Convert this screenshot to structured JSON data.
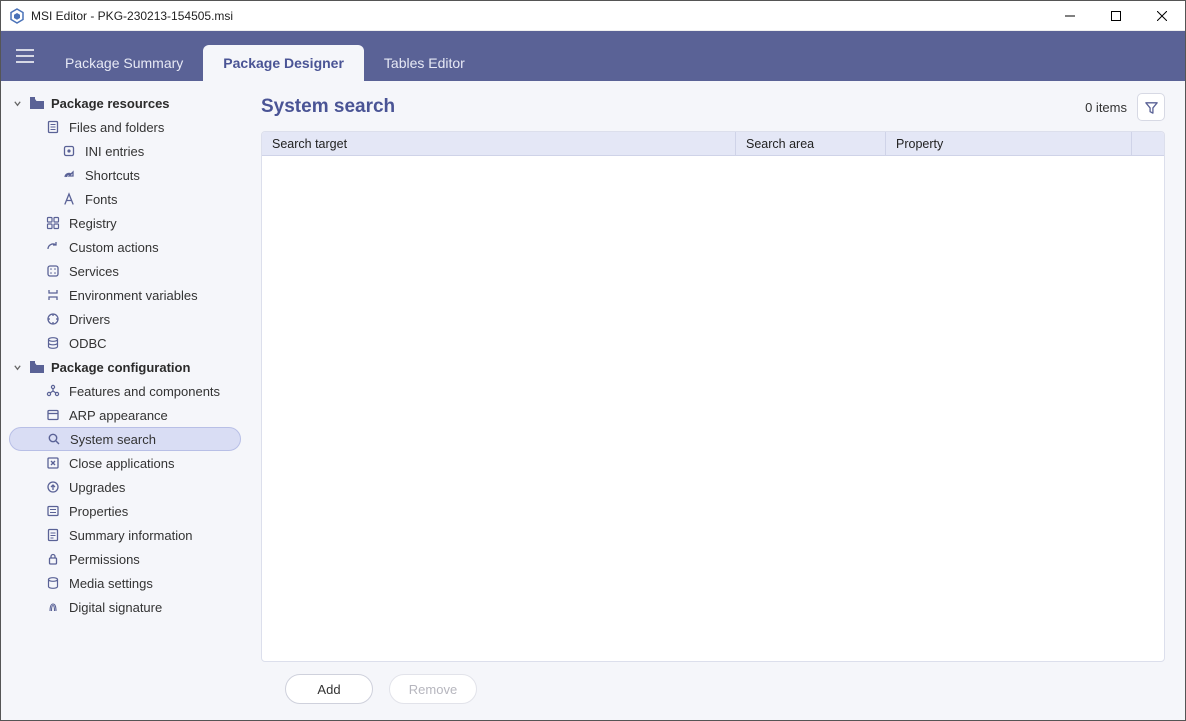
{
  "window": {
    "title": "MSI Editor - PKG-230213-154505.msi"
  },
  "nav": {
    "tabs": [
      {
        "label": "Package Summary",
        "active": false
      },
      {
        "label": "Package Designer",
        "active": true
      },
      {
        "label": "Tables Editor",
        "active": false
      }
    ]
  },
  "sidebar": {
    "resources": {
      "label": "Package resources",
      "items": {
        "files": {
          "label": "Files and folders"
        },
        "ini": {
          "label": "INI entries"
        },
        "shortcuts": {
          "label": "Shortcuts"
        },
        "fonts": {
          "label": "Fonts"
        },
        "registry": {
          "label": "Registry"
        },
        "custom": {
          "label": "Custom actions"
        },
        "services": {
          "label": "Services"
        },
        "envvars": {
          "label": "Environment variables"
        },
        "drivers": {
          "label": "Drivers"
        },
        "odbc": {
          "label": "ODBC"
        }
      }
    },
    "config": {
      "label": "Package configuration",
      "items": {
        "features": {
          "label": "Features and components"
        },
        "arp": {
          "label": "ARP appearance"
        },
        "search": {
          "label": "System search"
        },
        "closeapps": {
          "label": "Close applications"
        },
        "upgrades": {
          "label": "Upgrades"
        },
        "properties": {
          "label": "Properties"
        },
        "summary": {
          "label": "Summary information"
        },
        "perm": {
          "label": "Permissions"
        },
        "media": {
          "label": "Media settings"
        },
        "digsig": {
          "label": "Digital signature"
        }
      }
    }
  },
  "page": {
    "title": "System search",
    "item_count": "0 items",
    "columns": {
      "target": "Search target",
      "area": "Search area",
      "prop": "Property"
    },
    "actions": {
      "add": "Add",
      "remove": "Remove"
    }
  }
}
